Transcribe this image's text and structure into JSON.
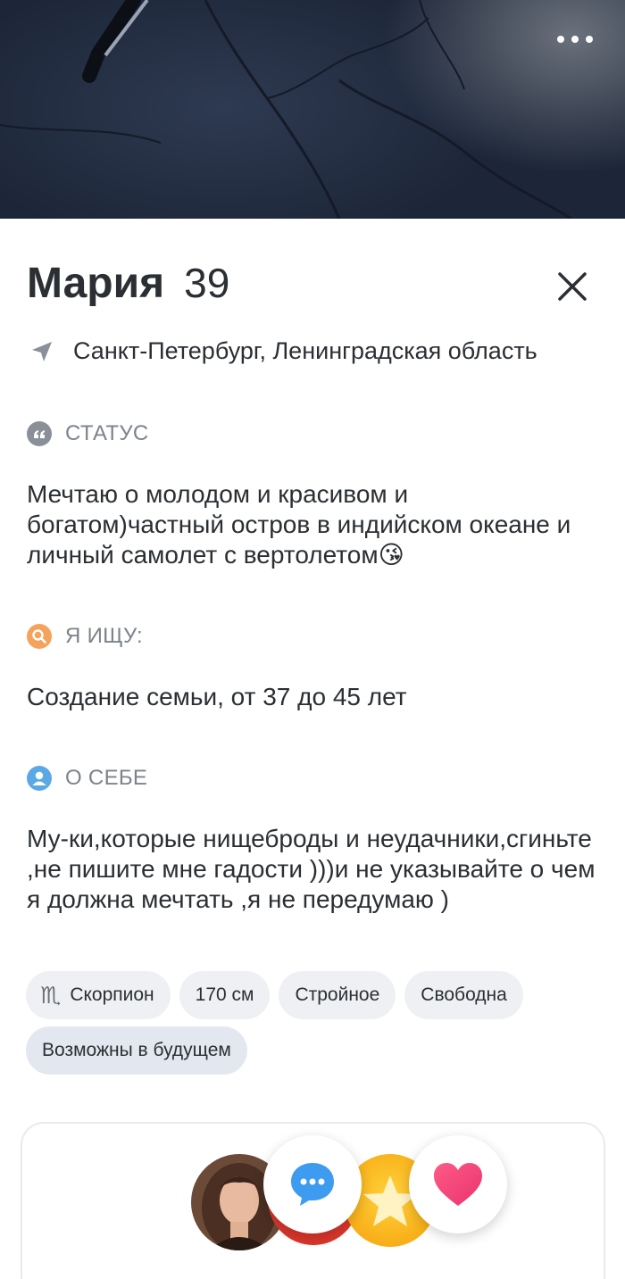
{
  "profile": {
    "name": "Мария",
    "age": "39",
    "location": "Санкт-Петербург, Ленинградская область"
  },
  "status": {
    "title": "СТАТУС",
    "text": "Мечтаю о молодом и красивом и богатом)частный остров в индийском океане и личный самолет с вертолетом😘",
    "icon": "quote-icon"
  },
  "looking_for": {
    "title": "Я ИЩУ:",
    "text": "Создание семьи, от 37 до 45 лет",
    "icon": "search-icon"
  },
  "about": {
    "title": "О СЕБЕ",
    "text": "Му-ки,которые нищеброды и неудачники,сгиньте ,не пишите мне гадости )))и не указывайте о чем я должна мечтать ,я не передумаю )",
    "icon": "user-icon"
  },
  "tags": {
    "zodiac_symbol": "♏",
    "zodiac": "Скорпион",
    "height": "170 см",
    "body": "Стройное",
    "relationship": "Свободна",
    "children": "Возможны в будущем"
  },
  "colors": {
    "accent_search": "#f5a35c",
    "accent_user": "#5aa9e6",
    "chat_blue": "#3d9bf0",
    "like_pink": "#f0487a"
  }
}
